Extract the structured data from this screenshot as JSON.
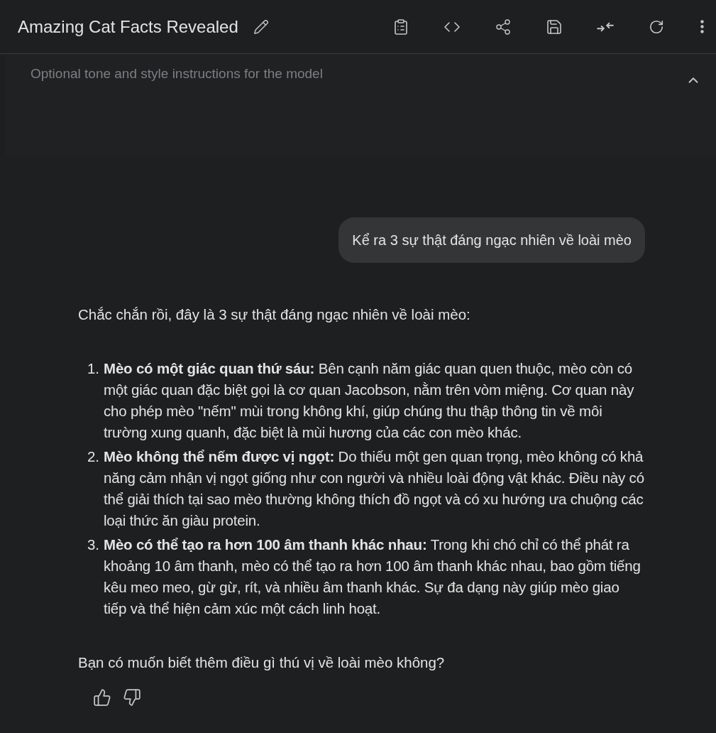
{
  "header": {
    "title": "Amazing Cat Facts Revealed"
  },
  "system_instructions": {
    "placeholder": "Optional tone and style instructions for the model",
    "expanded": true
  },
  "user_message": "Kể ra 3 sự thật đáng ngạc nhiên về loài mèo",
  "response": {
    "intro": "Chắc chắn rồi, đây là 3 sự thật đáng ngạc nhiên về loài mèo:",
    "items": [
      {
        "number": "1.",
        "title": "Mèo có một giác quan thứ sáu:",
        "text": "Bên cạnh năm giác quan quen thuộc, mèo còn có một giác quan đặc biệt gọi là cơ quan Jacobson, nằm trên vòm miệng. Cơ quan này cho phép mèo \"nếm\" mùi trong không khí, giúp chúng thu thập thông tin về môi trường xung quanh, đặc biệt là mùi hương của các con mèo khác."
      },
      {
        "number": "2.",
        "title": "Mèo không thể nếm được vị ngọt:",
        "text": "Do thiếu một gen quan trọng, mèo không có khả năng cảm nhận vị ngọt giống như con người và nhiều loài động vật khác. Điều này có thể giải thích tại sao mèo thường không thích đồ ngọt và có xu hướng ưa chuộng các loại thức ăn giàu protein."
      },
      {
        "number": "3.",
        "title": "Mèo có thể tạo ra hơn 100 âm thanh khác nhau:",
        "text": "Trong khi chó chỉ có thể phát ra khoảng 10 âm thanh, mèo có thể tạo ra hơn 100 âm thanh khác nhau, bao gồm tiếng kêu meo meo, gừ gừ, rít, và nhiều âm thanh khác. Sự đa dạng này giúp mèo giao tiếp và thể hiện cảm xúc một cách linh hoạt."
      }
    ],
    "outro": "Bạn có muốn biết thêm điều gì thú vị về loài mèo không?"
  }
}
